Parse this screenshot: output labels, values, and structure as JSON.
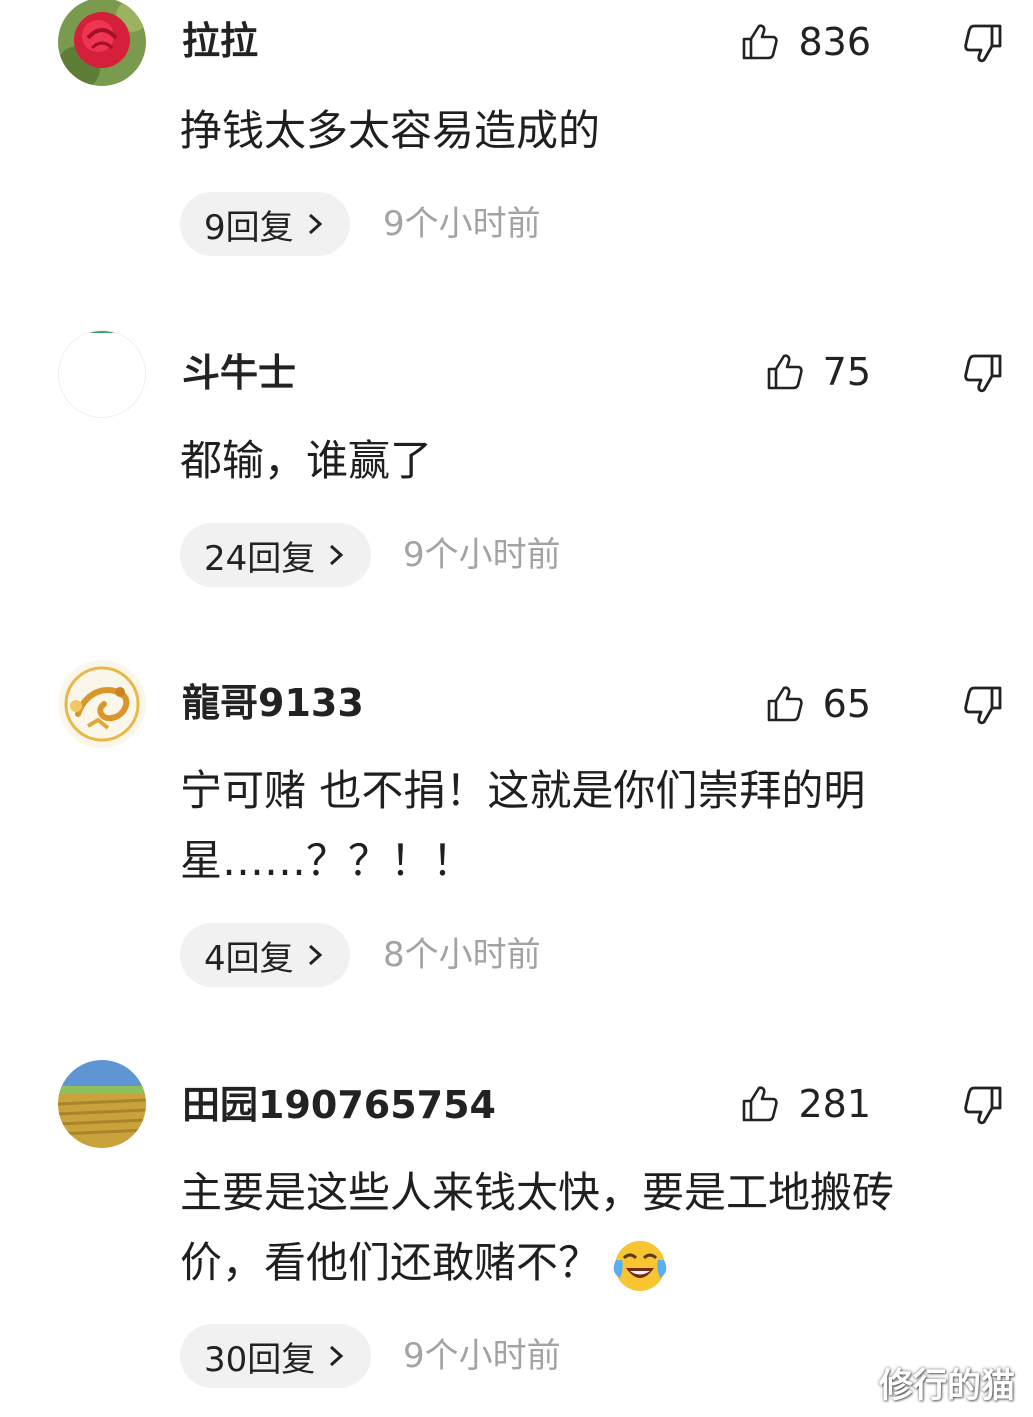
{
  "comments": [
    {
      "username": "拉拉",
      "likes": "836",
      "content_lines": [
        "挣钱太多太容易造成的"
      ],
      "replies": "9回复",
      "time": "9个小时前",
      "avatar": "rose-avatar"
    },
    {
      "username": "斗牛士",
      "likes": "75",
      "content_lines": [
        "都输，谁赢了"
      ],
      "replies": "24回复",
      "time": "9个小时前",
      "avatar": "blank-avatar"
    },
    {
      "username": "龍哥9133",
      "likes": "65",
      "content_lines": [
        "宁可赌 也不捐！这就是你们崇拜的明",
        "星……？？！！"
      ],
      "replies": "4回复",
      "time": "8个小时前",
      "avatar": "dragon-avatar"
    },
    {
      "username": "田园190765754",
      "likes": "281",
      "content_lines": [
        "主要是这些人来钱太快，要是工地搬砖",
        "价，看他们还敢赌不？"
      ],
      "replies": "30回复",
      "time": "9个小时前",
      "avatar": "field-avatar"
    }
  ],
  "icons": {
    "like": "thumb-up-icon",
    "dislike": "thumb-down-icon",
    "reply_chevron": "chevron-right-icon",
    "emoji": "crying-laughing-emoji"
  },
  "watermark": "修行的猫",
  "colors": {
    "text": "#222222",
    "muted": "#a3a3a3",
    "pill_bg": "#f1f1f1"
  }
}
